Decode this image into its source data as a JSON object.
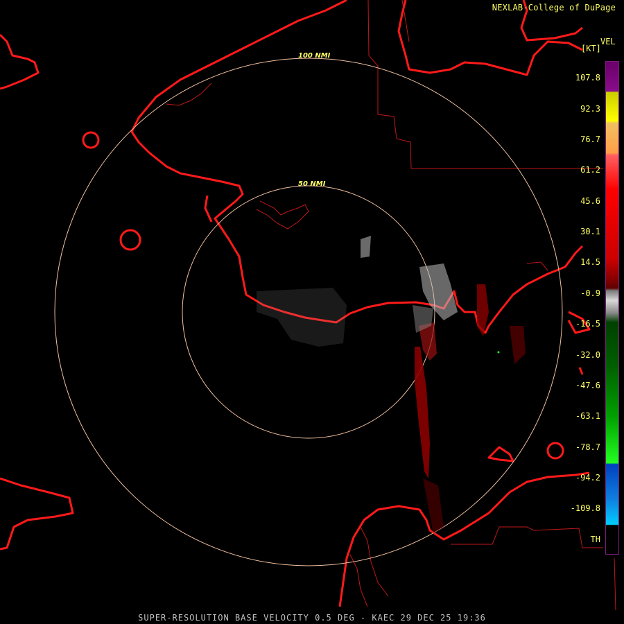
{
  "attribution": "NEXLAB-College of DuPage",
  "legend": {
    "title": "VEL",
    "unit": "[KT]",
    "labels": [
      "107.8",
      "92.3",
      "76.7",
      "61.2",
      "45.6",
      "30.1",
      "14.5",
      "-0.9",
      "-16.5",
      "-32.0",
      "-47.6",
      "-63.1",
      "-78.7",
      "-94.2",
      "-109.8",
      "TH"
    ]
  },
  "range_rings": [
    "100 NMI",
    "50 NMI"
  ],
  "footer": "SUPER-RESOLUTION BASE VELOCITY 0.5 DEG - KAEC 29 DEC 25 19:36",
  "colors": {
    "coastline": "#ff1a1a",
    "border": "#c01818",
    "ring": "#f0c0a0",
    "label_text": "#ffff66"
  }
}
